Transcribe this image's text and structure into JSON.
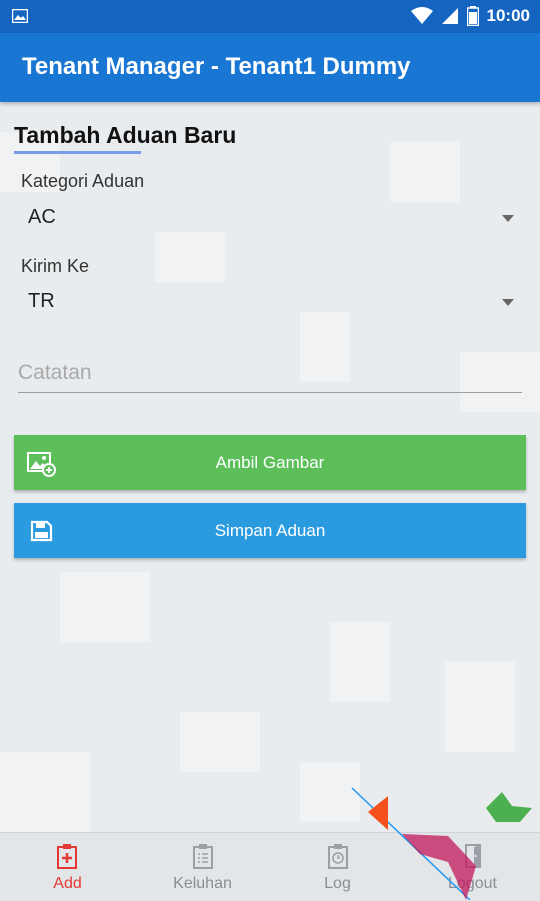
{
  "status_bar": {
    "time": "10:00"
  },
  "app_bar": {
    "title": "Tenant Manager - Tenant1 Dummy"
  },
  "form": {
    "title": "Tambah Aduan Baru",
    "category_label": "Kategori Aduan",
    "category_value": "AC",
    "send_to_label": "Kirim Ke",
    "send_to_value": "TR",
    "note_placeholder": "Catatan",
    "take_photo_label": "Ambil Gambar",
    "save_label": "Simpan Aduan"
  },
  "colors": {
    "status_bar": "#1565c0",
    "app_bar": "#1976d2",
    "take_photo_button": "#5cbf5a",
    "save_button": "#2b9be0",
    "nav_active": "#e53935"
  },
  "bottom_nav": {
    "items": [
      {
        "label": "Add",
        "icon": "add-clipboard-icon",
        "active": true
      },
      {
        "label": "Keluhan",
        "icon": "clipboard-list-icon",
        "active": false
      },
      {
        "label": "Log",
        "icon": "clipboard-clock-icon",
        "active": false
      },
      {
        "label": "Logout",
        "icon": "logout-door-icon",
        "active": false
      }
    ]
  }
}
